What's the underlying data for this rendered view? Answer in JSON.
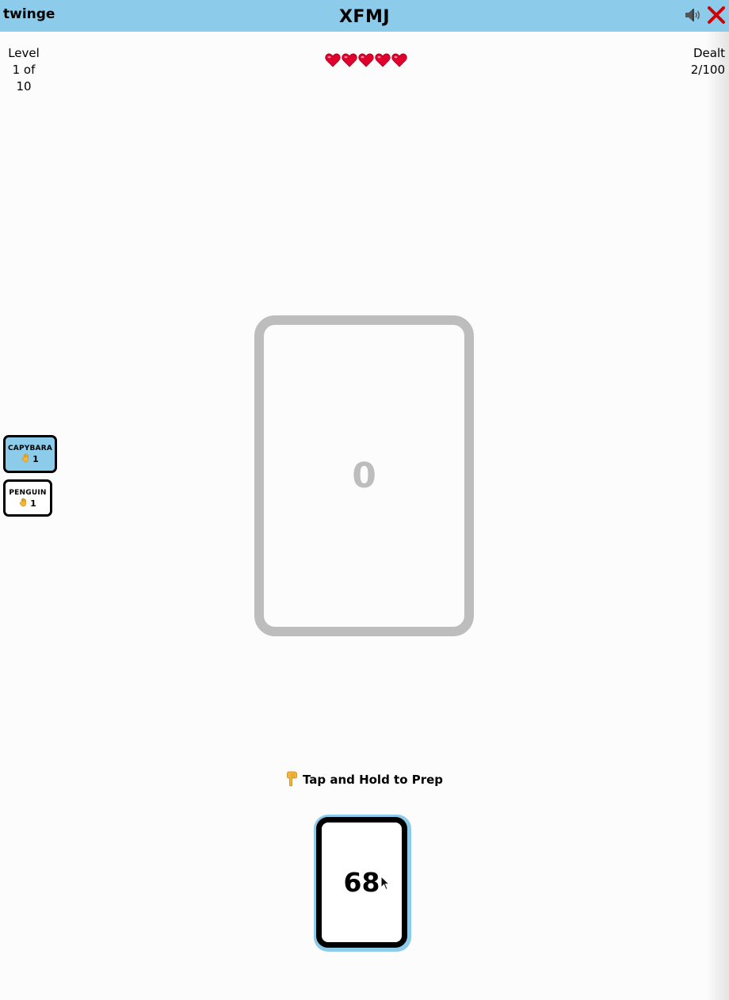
{
  "header": {
    "app_name": "twinge",
    "game_title": "XFMJ",
    "sound_icon": "speaker-icon",
    "close_icon": "close-icon"
  },
  "stats": {
    "level_label": "Level",
    "level_value": "1 of 10",
    "dealt_label": "Dealt",
    "dealt_value": "2/100",
    "lives_remaining": 5,
    "lives_icon": "heart-icon"
  },
  "pile": {
    "top_value": "0"
  },
  "players": [
    {
      "name": "CAPYBARA",
      "count": "1",
      "icon": "raised-hand-icon",
      "active": true
    },
    {
      "name": "PENGUIN",
      "count": "1",
      "icon": "raised-hand-icon",
      "active": false
    }
  ],
  "prompt": {
    "icon": "pointing-down-icon",
    "text": "Tap and Hold to Prep"
  },
  "hand": {
    "card_value": "68"
  },
  "colors": {
    "header_bg": "#8ccbe9",
    "active_player_bg": "#8ccbe9",
    "pile_card_color": "#bdbdbd",
    "close_icon": "#d40000",
    "heart": "#e0002b"
  }
}
